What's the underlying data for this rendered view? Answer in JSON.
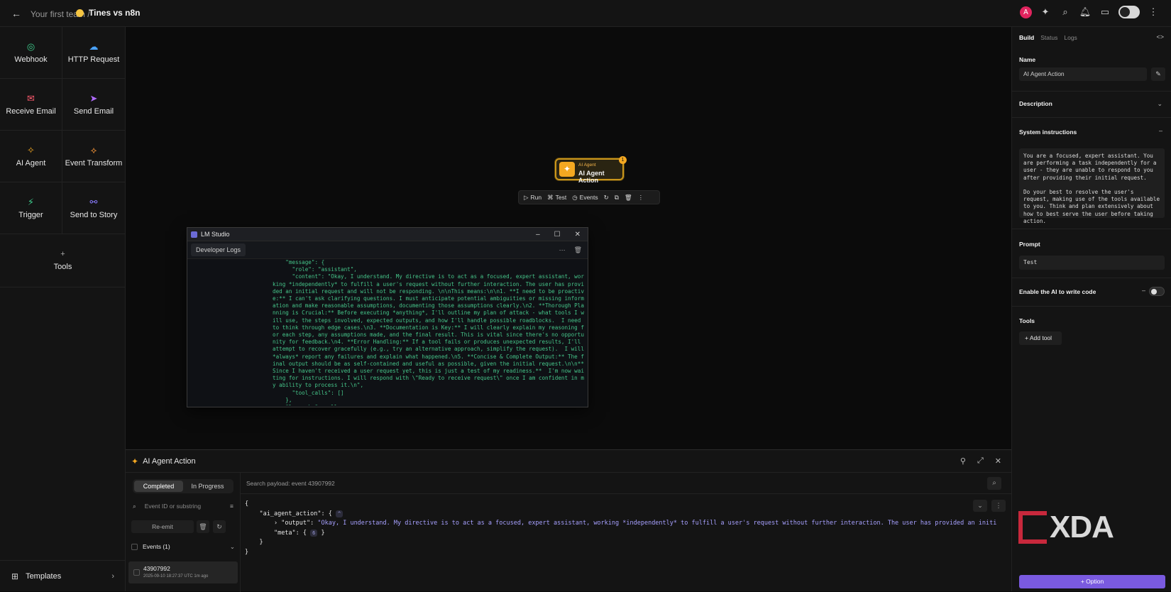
{
  "topbar": {
    "breadcrumb_team": "Your first team",
    "breadcrumb_sep": "/",
    "story_name": "Tines vs n8n",
    "avatar_letter": "A"
  },
  "left_panel": {
    "tiles": [
      {
        "label": "Webhook",
        "icon": "webhook-icon",
        "color": "#3ecf8e"
      },
      {
        "label": "HTTP Request",
        "icon": "cloud-icon",
        "color": "#4aa3ff"
      },
      {
        "label": "Receive Email",
        "icon": "email-icon",
        "color": "#ff5a6e"
      },
      {
        "label": "Send Email",
        "icon": "send-icon",
        "color": "#b06bff"
      },
      {
        "label": "AI Agent",
        "icon": "sparkle-icon",
        "color": "#f4a821"
      },
      {
        "label": "Event Transform",
        "icon": "transform-icon",
        "color": "#ff9a3a"
      },
      {
        "label": "Trigger",
        "icon": "bolt-icon",
        "color": "#3ecf8e"
      },
      {
        "label": "Send to Story",
        "icon": "story-icon",
        "color": "#8a7bff"
      }
    ],
    "tools_label": "Tools",
    "templates_label": "Templates"
  },
  "canvas": {
    "node_small": "AI Agent",
    "node_label": "AI Agent Action",
    "node_badge": "1",
    "toolbar": {
      "run": "Run",
      "test": "Test",
      "events": "Events"
    }
  },
  "lm_studio": {
    "title": "LM Studio",
    "tab": "Developer Logs",
    "log": "    \"message\": {\n      \"role\": \"assistant\",\n      \"content\": \"Okay, I understand. My directive is to act as a focused, expert assistant, working *independently* to fulfill a user's request without further interaction. The user has provided an initial request and will not be responding. \\n\\nThis means:\\n\\n1. **I need to be proactive:** I can't ask clarifying questions. I must anticipate potential ambiguities or missing information and make reasonable assumptions, documenting those assumptions clearly.\\n2. **Thorough Planning is Crucial:** Before executing *anything*, I'll outline my plan of attack - what tools I will use, the steps involved, expected outputs, and how I'll handle possible roadblocks.  I need to think through edge cases.\\n3. **Documentation is Key:** I will clearly explain my reasoning for each step, any assumptions made, and the final result. This is vital since there's no opportunity for feedback.\\n4. **Error Handling:** If a tool fails or produces unexpected results, I'll attempt to recover gracefully (e.g., try an alternative approach, simplify the request).  I will *always* report any failures and explain what happened.\\n5. **Concise & Complete Output:** The final output should be as self-contained and useful as possible, given the initial request.\\n\\n**Since I haven't received a user request yet, this is just a test of my readiness.**  I'm now waiting for instructions. I will respond with \\\"Ready to receive request\\\" once I am confident in my ability to process it.\\n\",\n      \"tool_calls\": []\n    },\n    \"logprobs\": null,\n    \"finish_reason\": \"stop\""
  },
  "bottom_panel": {
    "title": "AI Agent Action",
    "tab_completed": "Completed",
    "tab_in_progress": "In Progress",
    "event_search_placeholder": "Event ID or substring",
    "reemit": "Re-emit",
    "events_header": "Events (1)",
    "event": {
      "id": "43907992",
      "timestamp": "2025-09-10 18:27:37 UTC 1m ago"
    },
    "payload_search_placeholder": "Search payload: event 43907992",
    "code": {
      "open": "{",
      "key_action": "\"ai_agent_action\": {",
      "pill_action": "^",
      "key_output": "\"output\": ",
      "output_value": "\"Okay, I understand. My directive is to act as a focused, expert assistant, working *independently* to fulfill a user's request without further interaction. The user has provided an initial request an…\",",
      "key_meta": "\"meta\": {",
      "meta_count": "6",
      "close_meta": "}",
      "close_action": "}",
      "close": "}"
    }
  },
  "right_panel": {
    "tabs": [
      "Build",
      "Status",
      "Logs"
    ],
    "name_label": "Name",
    "name_value": "AI Agent Action",
    "description_label": "Description",
    "system_label": "System instructions",
    "system_text": "You are a focused, expert assistant. You are performing a task independently for a user - they are unable to respond to you after providing their initial request.\n\nDo your best to resolve the user's request, making use of the tools available to you. Think and plan extensively about how to best serve the user before taking action.",
    "prompt_label": "Prompt",
    "prompt_value": "Test",
    "code_label": "Enable the AI to write code",
    "tools_label": "Tools",
    "add_tool": "Add tool",
    "option_button": "Option"
  },
  "watermark": "XDA"
}
